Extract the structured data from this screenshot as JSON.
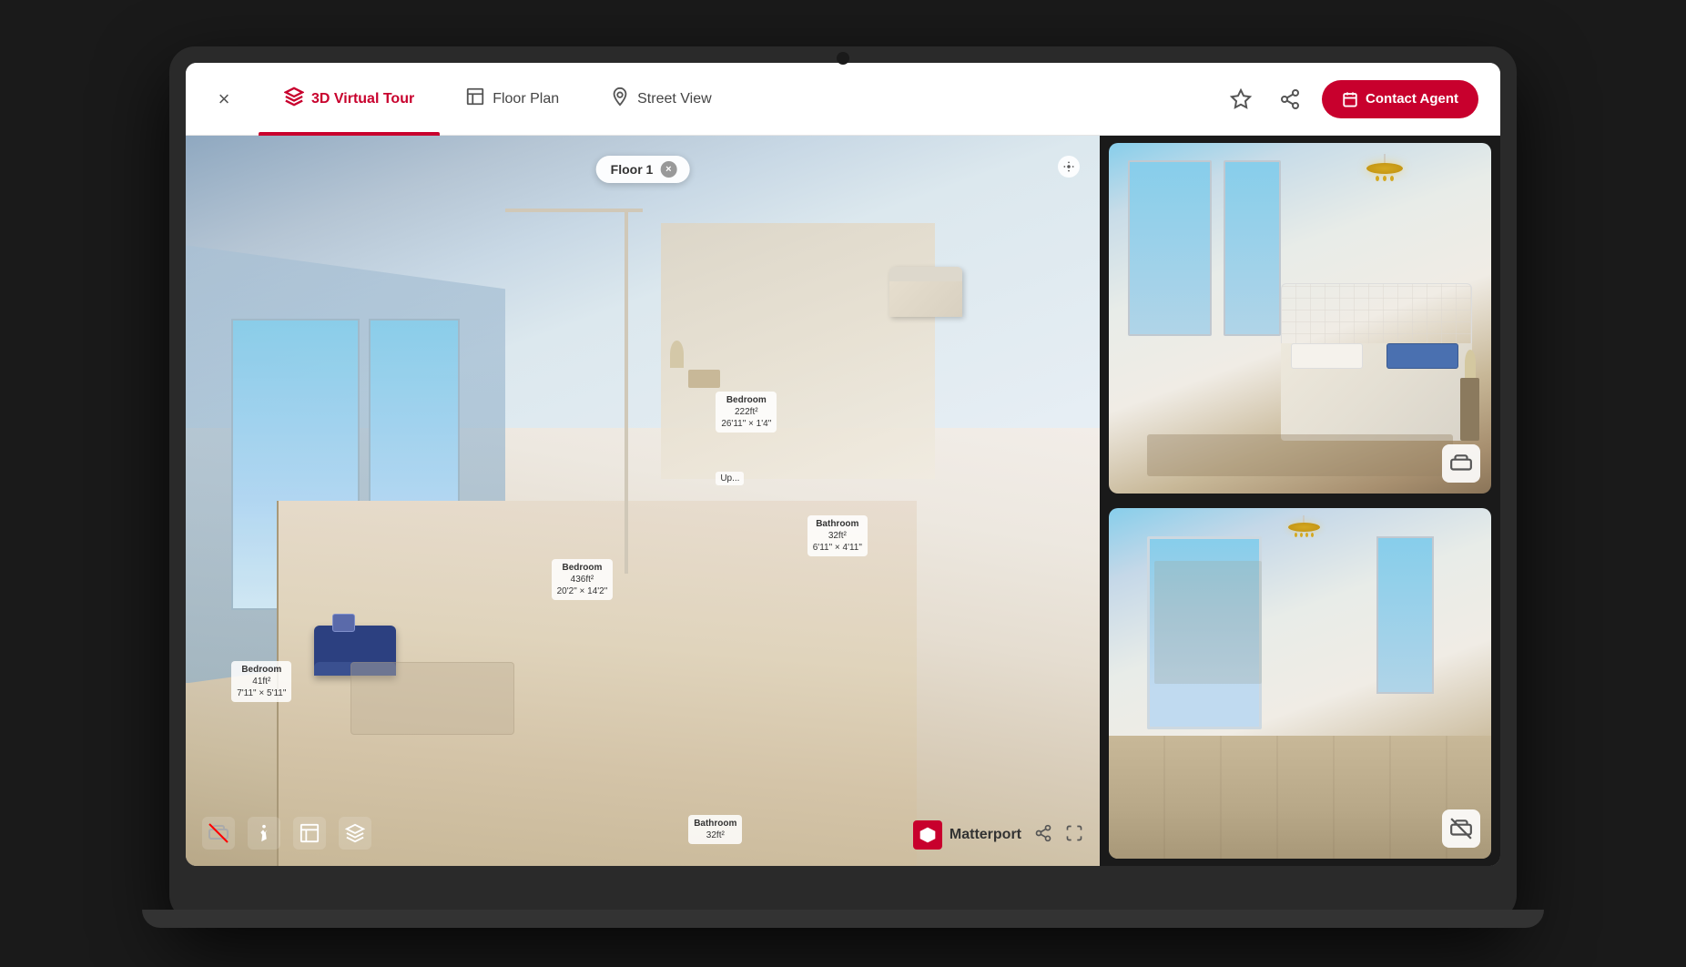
{
  "laptop": {
    "notch_alt": "Webcam notch"
  },
  "nav": {
    "close_label": "×",
    "tabs": [
      {
        "id": "3d-virtual-tour",
        "label": "3D Virtual Tour",
        "active": true,
        "icon": "🏠"
      },
      {
        "id": "floor-plan",
        "label": "Floor Plan",
        "active": false,
        "icon": "⬜"
      },
      {
        "id": "street-view",
        "label": "Street View",
        "active": false,
        "icon": "📍"
      }
    ],
    "save_icon": "☆",
    "share_icon": "↗",
    "contact_icon": "📅",
    "contact_label": "Contact Agent"
  },
  "tour": {
    "floor_selector": "Floor 1",
    "floor_close": "×",
    "settings_icon": "⚙",
    "rooms": [
      {
        "name": "Bedroom",
        "area": "222ft²",
        "dims": "26'11\" × 1'4\""
      },
      {
        "name": "Bedroom",
        "area": "436ft²",
        "dims": "20'2\" × 14'2\""
      },
      {
        "name": "Bedroom",
        "area": "41ft²",
        "dims": "7'11\" × 5'11\""
      },
      {
        "name": "Bathroom",
        "area": "32ft²",
        "dims": "6'11\" × 4'11\""
      }
    ],
    "toolbar": {
      "items": [
        {
          "id": "no-furniture",
          "icon": "🚫"
        },
        {
          "id": "person",
          "icon": "🚶"
        },
        {
          "id": "floorplan",
          "icon": "⬜"
        },
        {
          "id": "layers",
          "icon": "≡"
        }
      ]
    },
    "matterport": {
      "brand": "M",
      "text": "Matterport"
    }
  },
  "room_photos": [
    {
      "id": "bedroom-upper",
      "type": "bedroom",
      "has_furniture": true,
      "furniture_icon": "🛋"
    },
    {
      "id": "living-lower",
      "type": "living",
      "has_furniture": false,
      "no_furniture_icon": "🚫"
    }
  ],
  "colors": {
    "accent": "#c8002d",
    "dark_bg": "#1a1a1a",
    "nav_bg": "#ffffff",
    "active_tab": "#c8002d",
    "contact_btn": "#c8002d"
  }
}
